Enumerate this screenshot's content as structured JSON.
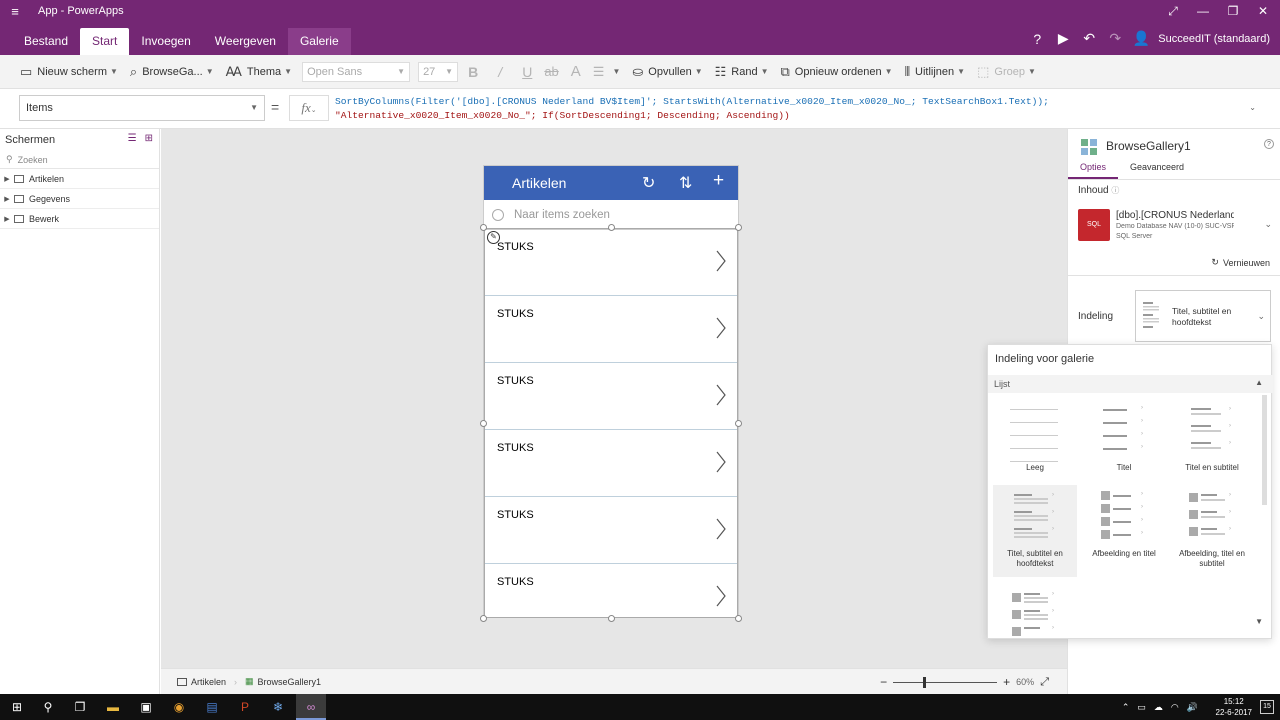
{
  "window": {
    "title": "App - PowerApps"
  },
  "ribbon": {
    "tabs": [
      "Bestand",
      "Start",
      "Invoegen",
      "Weergeven",
      "Galerie"
    ],
    "user": "SucceedIT (standaard)"
  },
  "toolbar": {
    "new_screen": "Nieuw scherm",
    "control_name": "BrowseGa...",
    "theme": "Thema",
    "font": "Open Sans",
    "font_size": "27",
    "bold": "B",
    "italic": "/",
    "underline": "U",
    "strike": "ab",
    "fontcolor": "A",
    "fill": "Opvullen",
    "border": "Rand",
    "reorder": "Opnieuw ordenen",
    "align": "Uitlijnen",
    "group": "Groep"
  },
  "formula": {
    "property": "Items",
    "equals": "=",
    "fx": "fx",
    "line1": "SortByColumns(Filter('[dbo].[CRONUS Nederland BV$Item]'; StartsWith(Alternative_x0020_Item_x0020_No_; TextSearchBox1.Text));",
    "line2": "\"Alternative_x0020_Item_x0020_No_\"; If(SortDescending1; Descending; Ascending))"
  },
  "left_pane": {
    "heading": "Schermen",
    "search_placeholder": "Zoeken",
    "screens": [
      "Artikelen",
      "Gegevens",
      "Bewerk"
    ]
  },
  "app_screen": {
    "title": "Artikelen",
    "search_placeholder": "Naar items zoeken",
    "rows": [
      "STUKS",
      "STUKS",
      "STUKS",
      "STUKS",
      "STUKS",
      "STUKS"
    ]
  },
  "status_bar": {
    "crumbs": [
      "Artikelen",
      "BrowseGallery1"
    ],
    "zoom_minus": "−",
    "zoom_plus": "+",
    "zoom": "60%",
    "zoom_fraction": 0.29
  },
  "right_pane": {
    "control_title": "BrowseGallery1",
    "tabs": [
      "Opties",
      "Geavanceerd"
    ],
    "content_label": "Inhoud",
    "datasource_title": "[dbo].[CRONUS Nederland B...",
    "datasource_sub": "Demo Database NAV (10-0) SUC-VSR-01...",
    "datasource_type": "SQL Server",
    "sql_badge": "SQL",
    "refresh": "Vernieuwen",
    "layout_label": "Indeling",
    "layout_value": "Titel, subtitel en hoofdtekst"
  },
  "layout_flyout": {
    "title": "Indeling voor galerie",
    "section": "Lijst",
    "options": [
      "Leeg",
      "Titel",
      "Titel en subtitel",
      "Titel, subtitel en hoofdtekst",
      "Afbeelding en titel",
      "Afbeelding, titel en subtitel"
    ]
  },
  "taskbar": {
    "time": "15:12",
    "date": "22-6-2017",
    "notification_count": "15"
  }
}
